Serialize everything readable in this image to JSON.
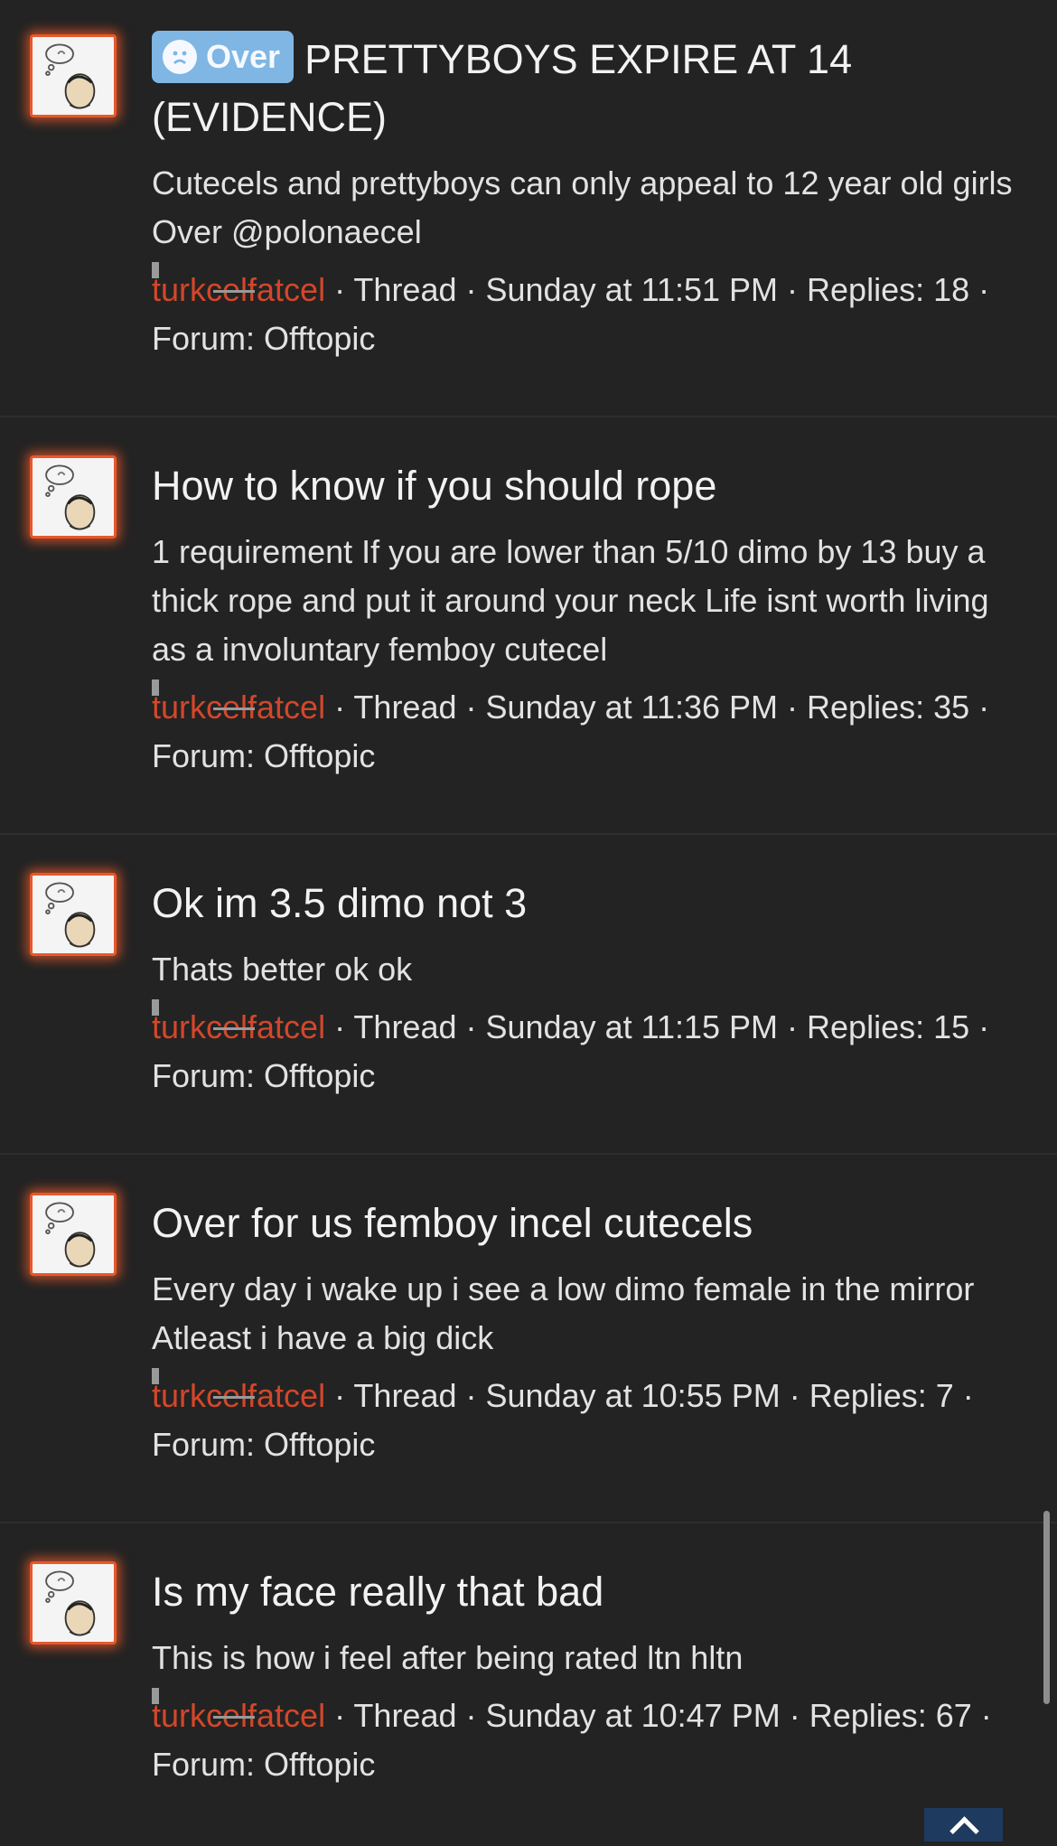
{
  "threads": [
    {
      "badge": "Over",
      "title": "PRETTYBOYS EXPIRE AT 14 (EVIDENCE)",
      "snippet": "Cutecels and prettyboys can only appeal to 12 year old girls Over @polonaecel",
      "author": "turkcelfatcel",
      "meta": "· Thread · Sunday at 11:51 PM · Replies: 18 · Forum: Offtopic"
    },
    {
      "badge": "",
      "title": "How to know if you should rope",
      "snippet": "1 requirement If you are lower than 5/10 dimo by 13 buy a thick rope and put it around your neck Life isnt worth living as a involuntary femboy cutecel",
      "author": "turkcelfatcel",
      "meta": "· Thread · Sunday at 11:36 PM · Replies: 35 · Forum: Offtopic"
    },
    {
      "badge": "",
      "title": "Ok im 3.5 dimo not 3",
      "snippet": "Thats better ok ok",
      "author": "turkcelfatcel",
      "meta": "· Thread · Sunday at 11:15 PM · Replies: 15 · Forum: Offtopic"
    },
    {
      "badge": "",
      "title": "Over for us femboy incel cutecels",
      "snippet": "Every day i wake up i see a low dimo female in the mirror Atleast i have a big dick",
      "author": "turkcelfatcel",
      "meta": "· Thread · Sunday at 10:55 PM · Replies: 7 · Forum: Offtopic"
    },
    {
      "badge": "",
      "title": "Is my face really that bad",
      "snippet": "This is how i feel after being rated ltn hltn",
      "author": "turkcelfatcel",
      "meta": "· Thread · Sunday at 10:47 PM · Replies: 67 · Forum: Offtopic"
    }
  ],
  "colors": {
    "background": "#232323",
    "author": "#d3472a",
    "badge": "#7fb6e3",
    "avatar_glow": "#e8582a"
  },
  "icons": {
    "avatar": "thinking-face-avatar-icon",
    "badge": "frown-face-icon",
    "scroll_top": "chevron-up-icon"
  }
}
